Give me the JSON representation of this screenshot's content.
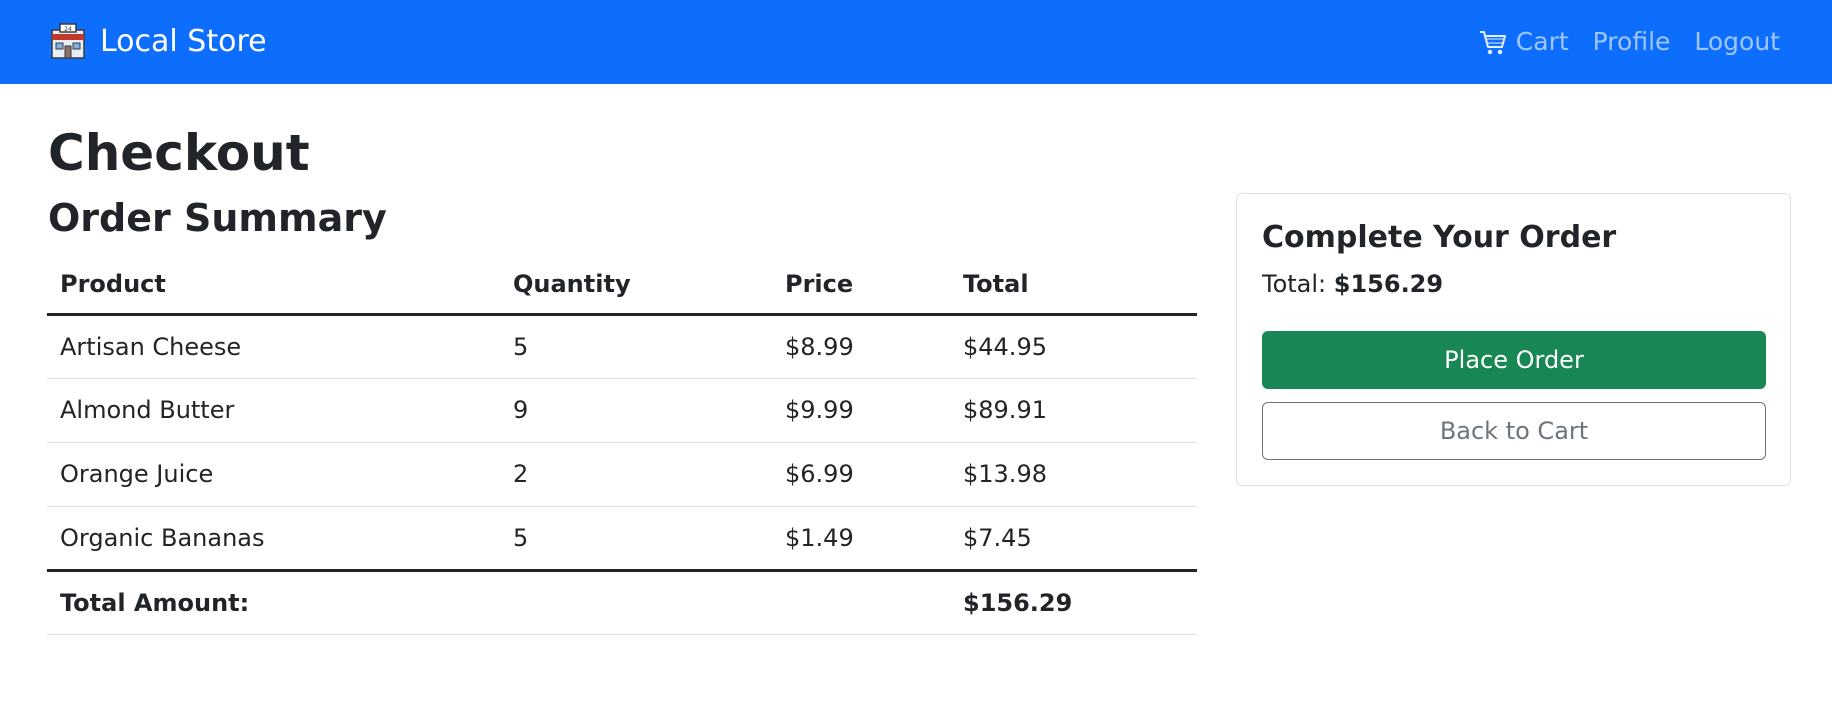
{
  "navbar": {
    "brand": "Local Store",
    "brand_icon": "store-icon",
    "links": {
      "cart": "Cart",
      "profile": "Profile",
      "logout": "Logout"
    },
    "cart_icon": "cart-icon",
    "background": "#0d6efd"
  },
  "page": {
    "title": "Checkout",
    "section_title": "Order Summary"
  },
  "table": {
    "headers": [
      "Product",
      "Quantity",
      "Price",
      "Total"
    ],
    "rows": [
      [
        "Artisan Cheese",
        "5",
        "$8.99",
        "$44.95"
      ],
      [
        "Almond Butter",
        "9",
        "$9.99",
        "$89.91"
      ],
      [
        "Orange Juice",
        "2",
        "$6.99",
        "$13.98"
      ],
      [
        "Organic Bananas",
        "5",
        "$1.49",
        "$7.45"
      ]
    ],
    "footer_label": "Total Amount:",
    "footer_total": "$156.29"
  },
  "card": {
    "title": "Complete Your Order",
    "total_label": "Total:",
    "total_value": "$156.29",
    "place_order": "Place Order",
    "back_to_cart": "Back to Cart"
  },
  "colors": {
    "primary": "#0d6efd",
    "success": "#198754",
    "secondary": "#6c757d"
  }
}
